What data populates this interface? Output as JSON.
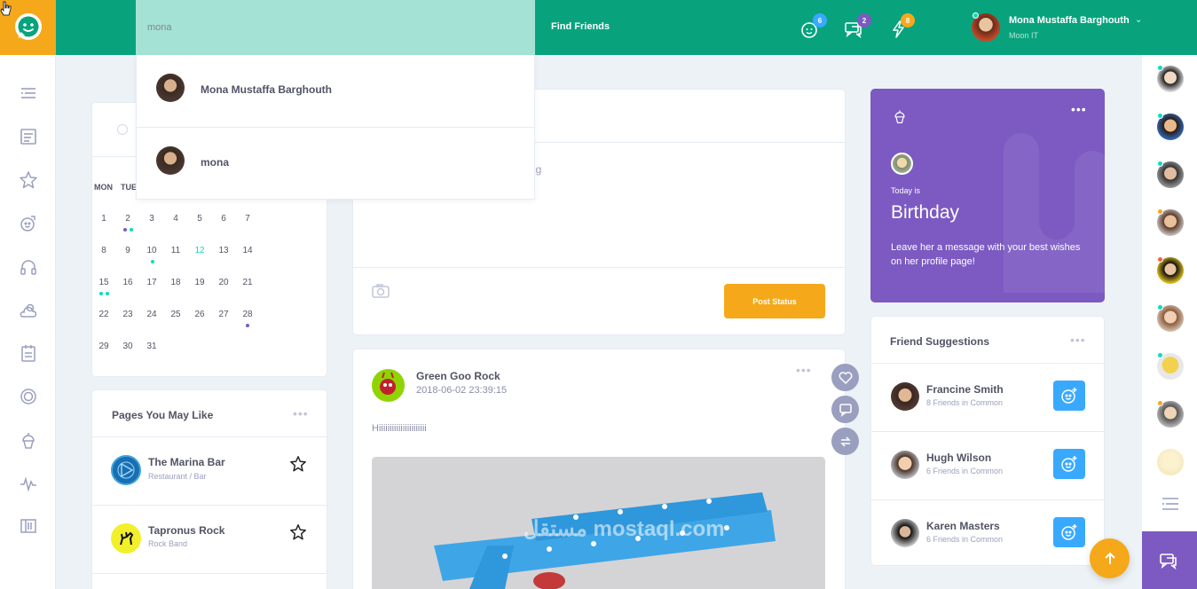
{
  "topbar": {
    "search_value": "mona",
    "find_friends": "Find Friends",
    "badges": {
      "friend_requests": "6",
      "messages": "2",
      "notifications": "8"
    },
    "user": {
      "name": "Mona Mustaffa Barghouth",
      "subtitle": "Moon IT"
    }
  },
  "search_results": [
    {
      "name": "Mona Mustaffa Barghouth"
    },
    {
      "name": "mona"
    }
  ],
  "calendar": {
    "weekday_headers": [
      "MON",
      "TUE"
    ],
    "weeks": [
      [
        "1",
        "2",
        "3",
        "4",
        "5",
        "6",
        "7"
      ],
      [
        "8",
        "9",
        "10",
        "11",
        "12",
        "13",
        "14"
      ],
      [
        "15",
        "16",
        "17",
        "18",
        "19",
        "20",
        "21"
      ],
      [
        "22",
        "23",
        "24",
        "25",
        "26",
        "27",
        "28"
      ],
      [
        "29",
        "30",
        "31"
      ]
    ]
  },
  "pages_widget": {
    "title": "Pages You May Like",
    "items": [
      {
        "name": "The Marina Bar",
        "category": "Restaurant / Bar"
      },
      {
        "name": "Tapronus Rock",
        "category": "Rock Band"
      }
    ]
  },
  "composer": {
    "placeholder_fragment": "ng",
    "post_button": "Post Status"
  },
  "post": {
    "author": "Green Goo Rock",
    "timestamp": "2018-06-02 23:39:15",
    "text": "Hiiiiiiiiiiiiiiiiiiiiii",
    "watermark": "مستقل mostaql.com"
  },
  "birthday": {
    "today_is": "Today is",
    "title": "Birthday",
    "message": "Leave her a message with your best wishes on her profile page!"
  },
  "friend_suggestions": {
    "title": "Friend Suggestions",
    "items": [
      {
        "name": "Francine Smith",
        "mutual": "8 Friends in Common"
      },
      {
        "name": "Hugh Wilson",
        "mutual": "6 Friends in Common"
      },
      {
        "name": "Karen Masters",
        "mutual": "6 Friends in Common"
      }
    ]
  },
  "colors": {
    "header": "#08a37d",
    "accent_orange": "#f6a81b",
    "purple": "#7c5ac2",
    "blue": "#38a9ff",
    "teal_dot": "#08ddc1"
  }
}
